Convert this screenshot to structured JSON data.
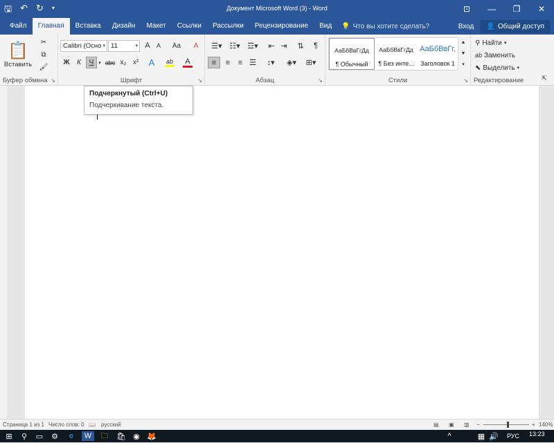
{
  "titlebar": {
    "title": "Документ Microsoft Word (3) - Word",
    "qat_icons": [
      "save-icon",
      "undo-icon",
      "redo-icon",
      "customize-qat-icon"
    ]
  },
  "tabs": [
    "Файл",
    "Главная",
    "Вставка",
    "Дизайн",
    "Макет",
    "Ссылки",
    "Рассылки",
    "Рецензирование",
    "Вид"
  ],
  "active_tab": "Главная",
  "tellme": {
    "placeholder": "Что вы хотите сделать?"
  },
  "account": {
    "signin": "Вход",
    "share": "Общий доступ"
  },
  "ribbon": {
    "clipboard": {
      "label": "Буфер обмена",
      "paste": "Вставить"
    },
    "font": {
      "label": "Шрифт",
      "font_name": "Calibri (Осно",
      "font_size": "11",
      "bold": "Ж",
      "italic": "К",
      "underline": "Ч",
      "strike": "abc",
      "subscript": "x₂",
      "superscript": "x²",
      "grow": "A",
      "shrink": "A",
      "case": "Aa",
      "highlight": "ab",
      "color": "A"
    },
    "paragraph": {
      "label": "Абзац"
    },
    "styles": {
      "label": "Стили",
      "items": [
        {
          "sample": "АаБбВвГгДд",
          "name": "¶ Обычный"
        },
        {
          "sample": "АаБбВвГгДд",
          "name": "¶ Без инте..."
        },
        {
          "sample": "АаБбВвГг,",
          "name": "Заголовок 1"
        }
      ]
    },
    "editing": {
      "label": "Редактирование",
      "find": "Найти",
      "replace": "Заменить",
      "select": "Выделить"
    }
  },
  "tooltip": {
    "title": "Подчеркнутый (Ctrl+U)",
    "description": "Подчеркивание текста."
  },
  "statusbar": {
    "page": "Страница 1 из 1",
    "words": "Число слов: 0",
    "language": "русский",
    "zoom": "140%"
  },
  "taskbar": {
    "language": "РУС",
    "time": "13:23"
  },
  "colors": {
    "accent": "#2b579a",
    "font_color_bar": "#e81123",
    "highlight_bar": "#ffff00",
    "heading_blue": "#2e74b5"
  }
}
